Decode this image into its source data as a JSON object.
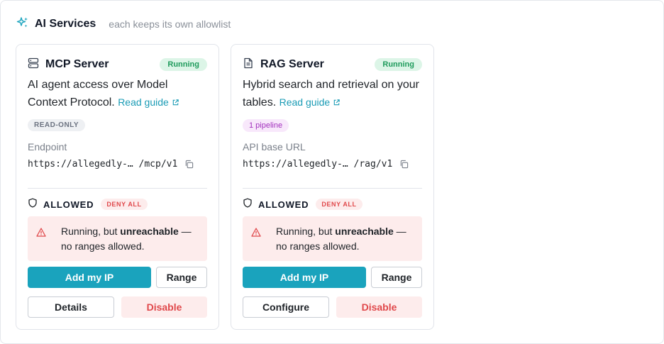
{
  "header": {
    "title": "AI Services",
    "subtitle": "each keeps its own allowlist",
    "icon": "sparkles-icon"
  },
  "colors": {
    "accent": "#1aa3bd",
    "running": "#1f9b5c",
    "danger": "#e0484b",
    "warn_bg": "#fdecec"
  },
  "cards": [
    {
      "icon": "server-icon",
      "title": "MCP Server",
      "status": "Running",
      "description": "AI agent access over Model Context Protocol.",
      "guide_link": "Read guide",
      "tag": "READ-ONLY",
      "field_label": "Endpoint",
      "field_value": "https://allegedly-… /mcp/v1",
      "allowed_label": "ALLOWED",
      "deny_badge": "DENY ALL",
      "warning_prefix": "Running, but ",
      "warning_bold": "unreachable",
      "warning_suffix": " — no ranges allowed.",
      "primary_button": "Add my IP",
      "range_button": "Range",
      "secondary_button": "Details",
      "disable_button": "Disable"
    },
    {
      "icon": "document-icon",
      "title": "RAG Server",
      "status": "Running",
      "description": "Hybrid search and retrieval on your tables.",
      "guide_link": "Read guide",
      "tag": "1 pipeline",
      "field_label": "API base URL",
      "field_value": "https://allegedly-… /rag/v1",
      "allowed_label": "ALLOWED",
      "deny_badge": "DENY ALL",
      "warning_prefix": "Running, but ",
      "warning_bold": "unreachable",
      "warning_suffix": " — no ranges allowed.",
      "primary_button": "Add my IP",
      "range_button": "Range",
      "secondary_button": "Configure",
      "disable_button": "Disable"
    }
  ]
}
